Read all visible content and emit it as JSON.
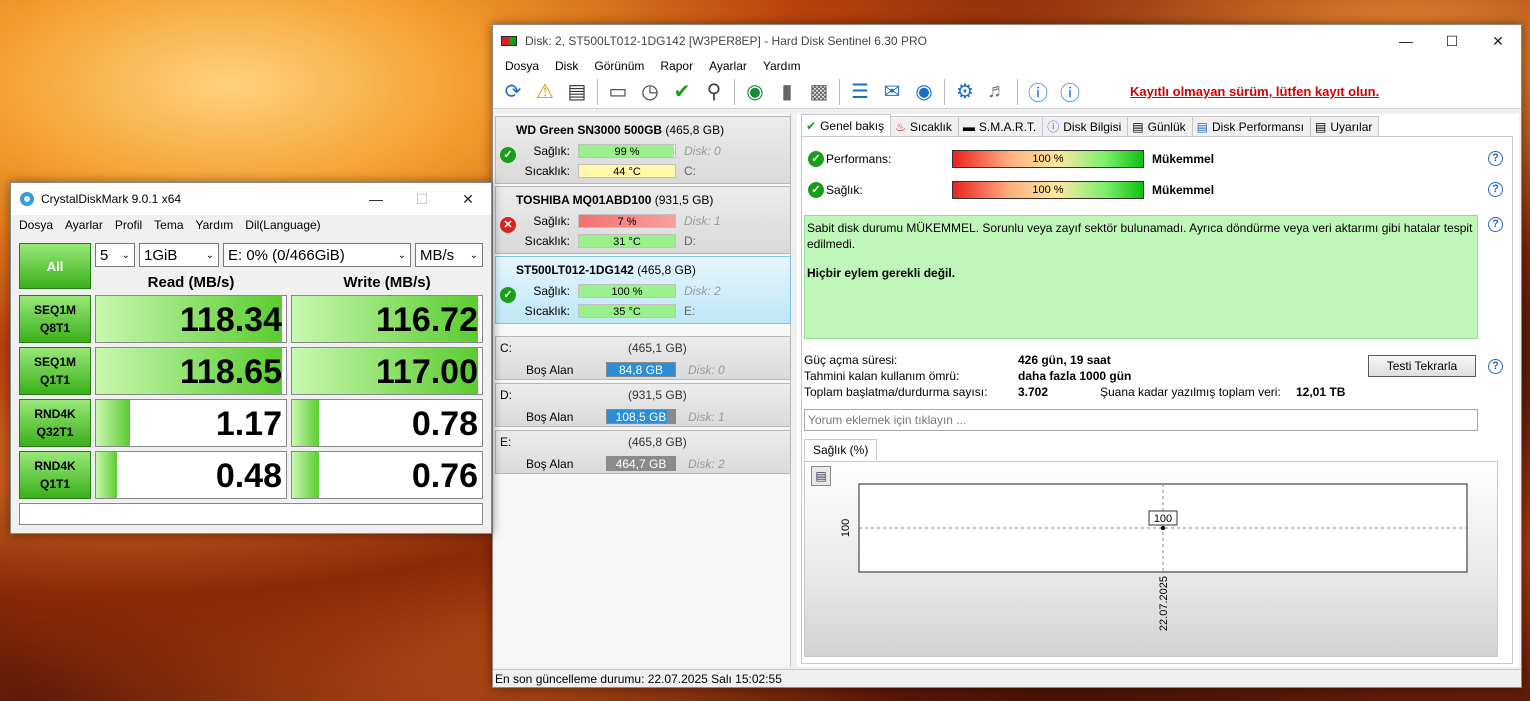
{
  "hds": {
    "title": "Disk: 2, ST500LT012-1DG142 [W3PER8EP]  -  Hard Disk Sentinel 6.30 PRO",
    "menu": [
      "Dosya",
      "Disk",
      "Görünüm",
      "Rapor",
      "Ayarlar",
      "Yardım"
    ],
    "unregistered": "Kayıtlı olmayan sürüm, lütfen kayıt olun.",
    "disks": [
      {
        "name": "WD Green SN3000 500GB",
        "size": "(465,8 GB)",
        "health_label": "Sağlık:",
        "health": "99 %",
        "health_pct": 99,
        "disk": "Disk: 0",
        "temp_label": "Sıcaklık:",
        "temp": "44 °C",
        "drive": "C:",
        "status": "ok"
      },
      {
        "name": "TOSHIBA MQ01ABD100",
        "size": "(931,5 GB)",
        "health_label": "Sağlık:",
        "health": "7 %",
        "health_pct": 7,
        "disk": "Disk: 1",
        "temp_label": "Sıcaklık:",
        "temp": "31 °C",
        "drive": "D:",
        "status": "bad"
      },
      {
        "name": "ST500LT012-1DG142",
        "size": "(465,8 GB)",
        "health_label": "Sağlık:",
        "health": "100 %",
        "health_pct": 100,
        "disk": "Disk: 2",
        "temp_label": "Sıcaklık:",
        "temp": "35 °C",
        "drive": "E:",
        "status": "ok"
      }
    ],
    "volumes": [
      {
        "letter": "C:",
        "size": "(465,1 GB)",
        "free_label": "Boş Alan",
        "free": "84,8 GB",
        "disk": "Disk: 0",
        "color": "#2a8ed8"
      },
      {
        "letter": "D:",
        "size": "(931,5 GB)",
        "free_label": "Boş Alan",
        "free": "108,5 GB",
        "disk": "Disk: 1",
        "color": "#2a8ed8"
      },
      {
        "letter": "E:",
        "size": "(465,8 GB)",
        "free_label": "Boş Alan",
        "free": "464,7 GB",
        "disk": "Disk: 2",
        "color": "#8a8a8a"
      }
    ],
    "tabs": [
      "Genel bakış",
      "Sıcaklık",
      "S.M.A.R.T.",
      "Disk Bilgisi",
      "Günlük",
      "Disk Performansı",
      "Uyarılar"
    ],
    "performance_label": "Performans:",
    "performance": "100 %",
    "performance_text": "Mükemmel",
    "health_label": "Sağlık:",
    "health": "100 %",
    "health_text": "Mükemmel",
    "status_text": "Sabit disk durumu MÜKEMMEL. Sorunlu veya zayıf sektör bulunamadı. Ayrıca döndürme veya veri aktarımı gibi hatalar tespit edilmedi.",
    "status_action": "Hiçbir eylem gerekli değil.",
    "power_on_label": "Güç açma süresi:",
    "power_on": "426 gün, 19 saat",
    "lifetime_label": "Tahmini kalan kullanım ömrü:",
    "lifetime": "daha fazla 1000 gün",
    "startstop_label": "Toplam başlatma/durdurma sayısı:",
    "startstop": "3.702",
    "written_label": "Şuana kadar yazılmış toplam veri:",
    "written": "12,01 TB",
    "retest": "Testi Tekrarla",
    "comment_placeholder": "Yorum eklemek için tıklayın ...",
    "chart_tab": "Sağlık (%)",
    "status_bar": "En son güncelleme durumu: 22.07.2025 Salı 15:02:55"
  },
  "chart_data": {
    "type": "line",
    "title": "Sağlık (%)",
    "x": [
      "22.07.2025"
    ],
    "series": [
      {
        "values": [
          100
        ]
      }
    ],
    "ytick": "100",
    "point_label": "100",
    "grid": true
  },
  "cdm": {
    "title": "CrystalDiskMark 9.0.1 x64",
    "menu": [
      "Dosya",
      "Ayarlar",
      "Profil",
      "Tema",
      "Yardım",
      "Dil(Language)"
    ],
    "all": "All",
    "count": "5",
    "size": "1GiB",
    "drive": "E: 0% (0/466GiB)",
    "unit": "MB/s",
    "read_header": "Read (MB/s)",
    "write_header": "Write (MB/s)",
    "tests": [
      {
        "l1": "SEQ1M",
        "l2": "Q8T1",
        "read": "118.34",
        "write": "116.72",
        "rfill": 0.98,
        "wfill": 0.98
      },
      {
        "l1": "SEQ1M",
        "l2": "Q1T1",
        "read": "118.65",
        "write": "117.00",
        "rfill": 0.98,
        "wfill": 0.98
      },
      {
        "l1": "RND4K",
        "l2": "Q32T1",
        "read": "1.17",
        "write": "0.78",
        "rfill": 0.18,
        "wfill": 0.14
      },
      {
        "l1": "RND4K",
        "l2": "Q1T1",
        "read": "0.48",
        "write": "0.76",
        "rfill": 0.11,
        "wfill": 0.14
      }
    ]
  }
}
